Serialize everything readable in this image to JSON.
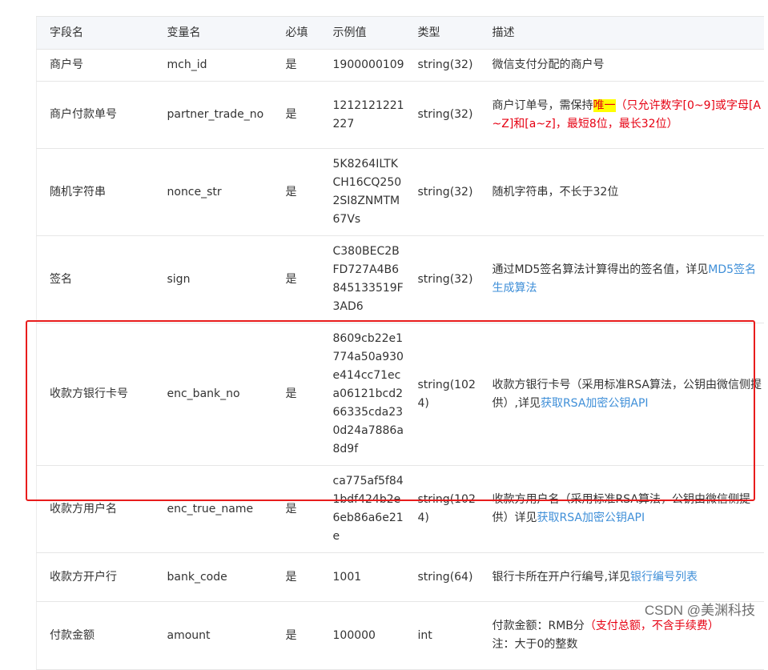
{
  "table": {
    "headers": [
      "字段名",
      "变量名",
      "必填",
      "示例值",
      "类型",
      "描述"
    ],
    "rows": [
      {
        "field": "商户号",
        "var": "mch_id",
        "required": "是",
        "example": "1900000109",
        "type": "string(32)",
        "desc": "微信支付分配的商户号"
      },
      {
        "field": "商户付款单号",
        "var": "partner_trade_no",
        "required": "是",
        "example": "1212121221227",
        "type": "string(32)",
        "desc_a": "商户订单号，需保持",
        "desc_hl": "唯一",
        "desc_red": "（只允许数字[0~9]或字母[A~Z]和[a~z]，最短8位，最长32位）"
      },
      {
        "field": "随机字符串",
        "var": "nonce_str",
        "required": "是",
        "example": "5K8264ILTKCH16CQ2502SI8ZNMTM67Vs",
        "type": "string(32)",
        "desc": "随机字符串，不长于32位"
      },
      {
        "field": "签名",
        "var": "sign",
        "required": "是",
        "example": "C380BEC2BFD727A4B6845133519F3AD6",
        "type": "string(32)",
        "desc_a": "通过MD5签名算法计算得出的签名值，详见",
        "desc_link": "MD5签名生成算法"
      },
      {
        "field": "收款方银行卡号",
        "var": "enc_bank_no",
        "required": "是",
        "example": "8609cb22e1774a50a930e414cc71eca06121bcd266335cda230d24a7886a8d9f",
        "type": "string(1024)",
        "desc_a": "收款方银行卡号（采用标准RSA算法，公钥由微信侧提供）,详见",
        "desc_link": "获取RSA加密公钥API"
      },
      {
        "field": "收款方用户名",
        "var": "enc_true_name",
        "required": "是",
        "example": "ca775af5f841bdf424b2e6eb86a6e21e",
        "type": "string(1024)",
        "desc_a": "收款方用户名（采用标准RSA算法，公钥由微信侧提供）详见",
        "desc_link": "获取RSA加密公钥API"
      },
      {
        "field": "收款方开户行",
        "var": "bank_code",
        "required": "是",
        "example": "1001",
        "type": "string(64)",
        "desc_a": "银行卡所在开户行编号,详见",
        "desc_link": "银行编号列表"
      },
      {
        "field": "付款金额",
        "var": "amount",
        "required": "是",
        "example": "100000",
        "type": "int",
        "desc_a": "付款金额：RMB分",
        "desc_red": "（支付总额，不含手续费）",
        "desc_note": "注：大于0的整数"
      }
    ]
  },
  "watermark": "CSDN @美渊科技",
  "colors": {
    "highlight_border": "#e81c1c",
    "link": "#3f8fd8",
    "warning": "#e60012"
  }
}
